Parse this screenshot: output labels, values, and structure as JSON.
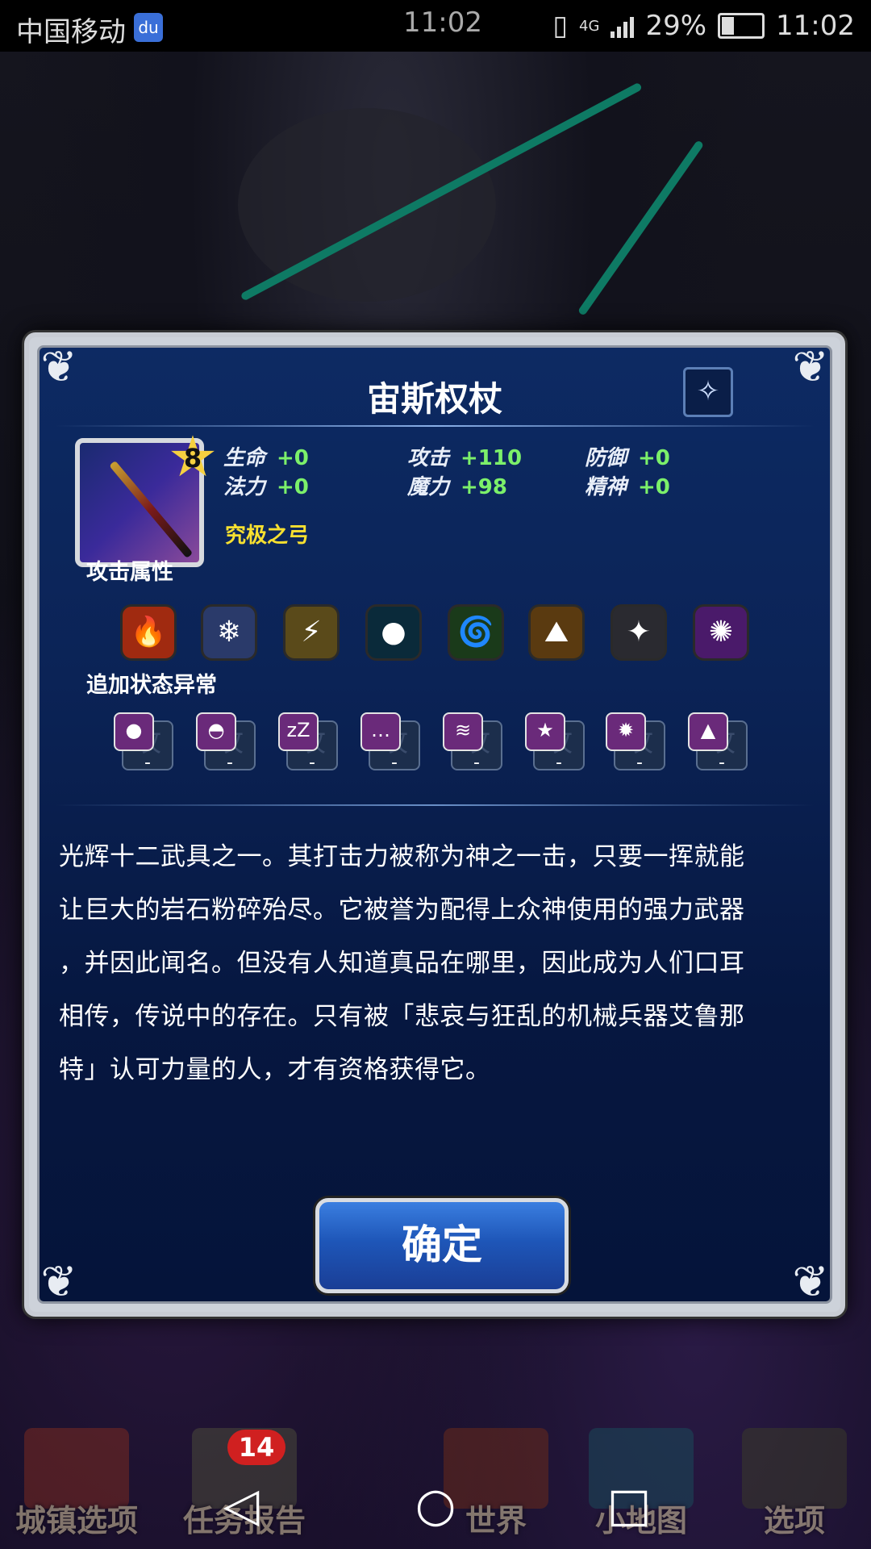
{
  "status_bar": {
    "carrier": "中国移动",
    "app_badge": "du",
    "center_time": "11:02",
    "network": "4G",
    "battery": "29%",
    "time": "11:02"
  },
  "dialog": {
    "title": "宙斯权杖",
    "weapon_type_icon": "staff-icon",
    "rarity": "8",
    "stats": {
      "hp_label": "生命",
      "hp_value": "+0",
      "atk_label": "攻击",
      "atk_value": "+110",
      "def_label": "防御",
      "def_value": "+0",
      "mp_label": "法力",
      "mp_value": "+0",
      "mag_label": "魔力",
      "mag_value": "+98",
      "spr_label": "精神",
      "spr_value": "+0"
    },
    "ultimate_label": "究极之弓",
    "attack_element_label": "攻击属性",
    "elements": [
      {
        "name": "fire-icon",
        "glyph": "🔥",
        "color": "#a02a10"
      },
      {
        "name": "ice-icon",
        "glyph": "❄",
        "color": "#2a3a6a"
      },
      {
        "name": "lightning-icon",
        "glyph": "⚡",
        "color": "#5a4a1a"
      },
      {
        "name": "water-icon",
        "glyph": "●",
        "color": "#0a2a3a"
      },
      {
        "name": "wind-icon",
        "glyph": "🌀",
        "color": "#1a3a1a"
      },
      {
        "name": "earth-icon",
        "glyph": "⛰",
        "color": "#5a3a10"
      },
      {
        "name": "holy-icon",
        "glyph": "✦",
        "color": "#2a2a30"
      },
      {
        "name": "dark-icon",
        "glyph": "✺",
        "color": "#4a1a6a"
      }
    ],
    "status_ailment_label": "追加状态异常",
    "status_slots": [
      {
        "name": "poison-icon",
        "glyph": "●",
        "base": "攻",
        "value": "-"
      },
      {
        "name": "blind-icon",
        "glyph": "◓",
        "base": "攻",
        "value": "-"
      },
      {
        "name": "sleep-icon",
        "glyph": "zZ",
        "base": "攻",
        "value": "-"
      },
      {
        "name": "silence-icon",
        "glyph": "…",
        "base": "攻",
        "value": "-"
      },
      {
        "name": "paralyze-icon",
        "glyph": "≋",
        "base": "攻",
        "value": "-"
      },
      {
        "name": "confuse-icon",
        "glyph": "★",
        "base": "攻",
        "value": "-"
      },
      {
        "name": "stun-icon",
        "glyph": "✹",
        "base": "攻",
        "value": "-"
      },
      {
        "name": "petrify-icon",
        "glyph": "▲",
        "base": "攻",
        "value": "-"
      }
    ],
    "description_lines": [
      "光辉十二武具之一。其打击力被称为神之一击，只要一挥就能",
      "让巨大的岩石粉碎殆尽。它被誉为配得上众神使用的强力武器",
      "，并因此闻名。但没有人知道真品在哪里，因此成为人们口耳",
      "相传，传说中的存在。只有被「悲哀与狂乱的机械兵器艾鲁那",
      "特」认可力量的人，才有资格获得它。"
    ],
    "confirm_label": "确定"
  },
  "bottom_nav": {
    "items": [
      "城镇选项",
      "任务报告",
      "世界",
      "小地图",
      "选项"
    ],
    "quest_badge": "14"
  },
  "colors": {
    "stat_value": "#7cf06a",
    "ultimate": "#f8e030",
    "dialog_bg": "#0b2356",
    "button": "#1e56b8"
  }
}
